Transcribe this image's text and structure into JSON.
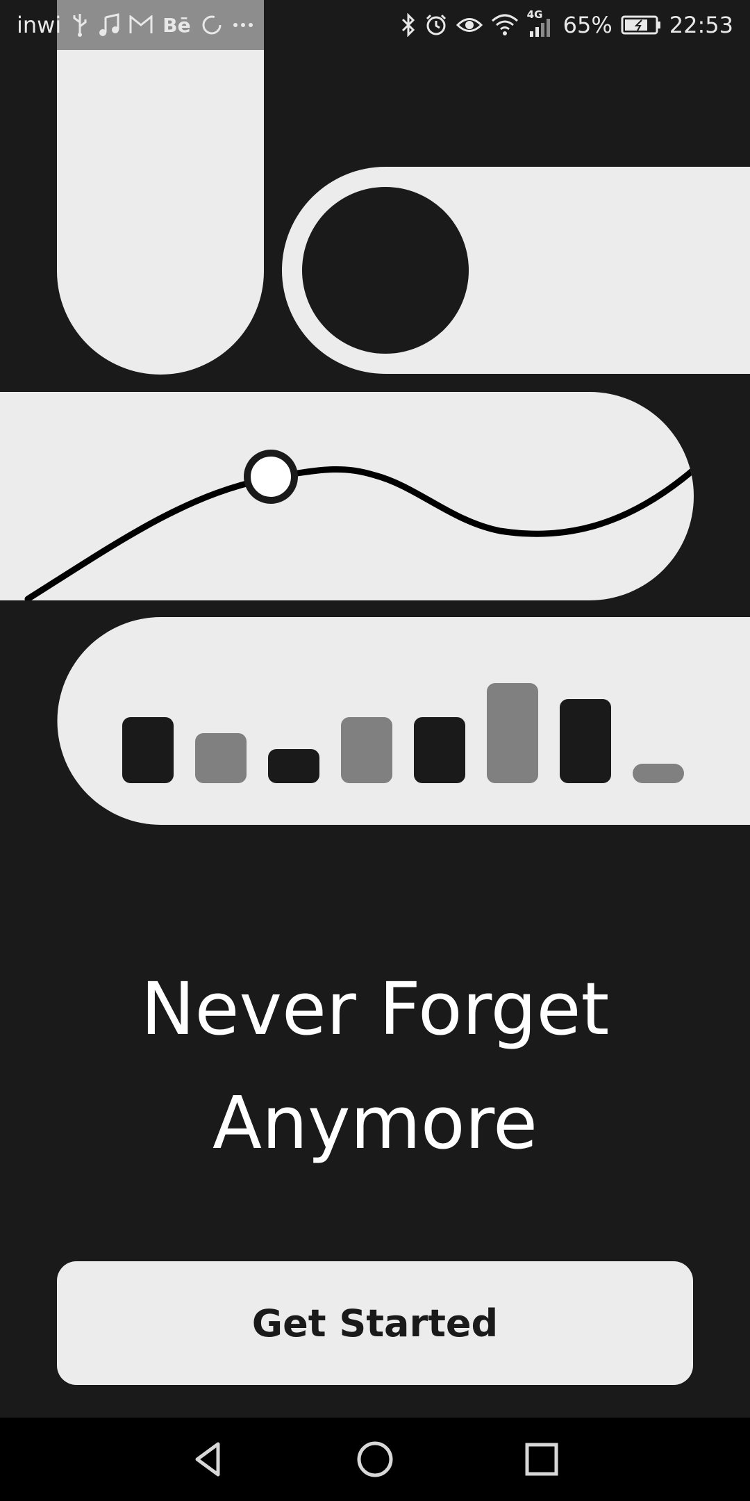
{
  "status_bar": {
    "carrier": "inwi",
    "battery_percent": "65%",
    "time": "22:53",
    "network_type": "4G",
    "left_icons": [
      "usb-icon",
      "music-icon",
      "gmail-icon",
      "behance-icon",
      "loading-icon",
      "more-icon"
    ],
    "right_icons": [
      "bluetooth-icon",
      "alarm-icon",
      "eye-icon",
      "wifi-icon",
      "signal-icon",
      "battery-icon"
    ]
  },
  "onboarding": {
    "headline_line1": "Never Forget",
    "headline_line2": "Anymore",
    "cta_label": "Get Started"
  },
  "illustration": {
    "bar_levels": [
      0.53,
      0.4,
      0.27,
      0.53,
      0.53,
      0.8,
      0.67,
      0.13
    ],
    "bar_shades": [
      "dark",
      "gray",
      "dark",
      "gray",
      "dark",
      "gray",
      "dark",
      "gray"
    ]
  },
  "colors": {
    "background": "#1a1a1a",
    "shape_light": "#ececec",
    "shape_dark": "#1a1a1a",
    "bar_gray": "#808080",
    "text_light": "#ffffff",
    "nav_bar": "#000000"
  },
  "nav_bar": {
    "back_icon": "back-triangle-icon",
    "home_icon": "home-circle-icon",
    "recents_icon": "recents-square-icon"
  }
}
